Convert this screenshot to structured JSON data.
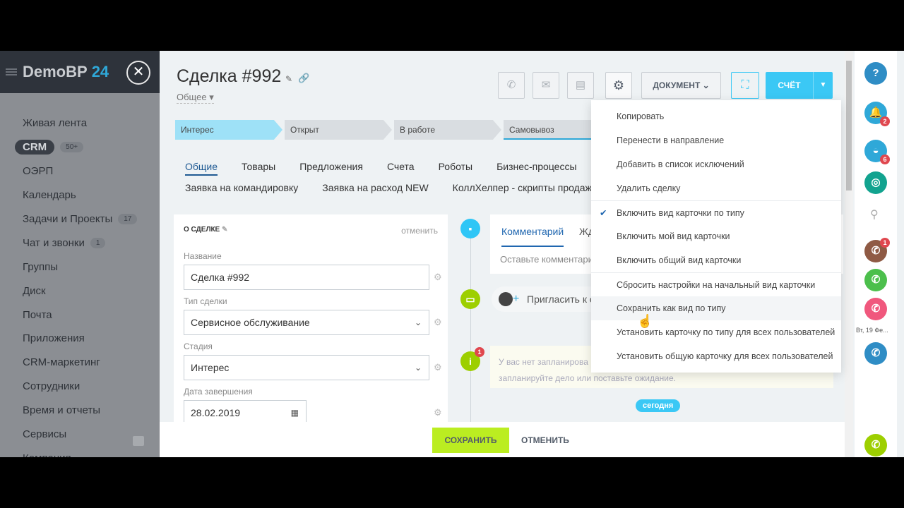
{
  "sidebar": {
    "logo": "DemoBP",
    "logo_num": "24",
    "items": [
      {
        "label": "Живая лента"
      },
      {
        "label": "CRM",
        "count": "50+"
      },
      {
        "label": "ОЭРП"
      },
      {
        "label": "Календарь"
      },
      {
        "label": "Задачи и Проекты",
        "count": "17"
      },
      {
        "label": "Чат и звонки",
        "count": "1"
      },
      {
        "label": "Группы"
      },
      {
        "label": "Диск"
      },
      {
        "label": "Почта"
      },
      {
        "label": "Приложения"
      },
      {
        "label": "CRM-маркетинг"
      },
      {
        "label": "Сотрудники"
      },
      {
        "label": "Время и отчеты"
      },
      {
        "label": "Сервисы"
      },
      {
        "label": "Компания"
      }
    ]
  },
  "header": {
    "title": "Сделка #992",
    "category": "Общее",
    "document_label": "ДОКУМЕНТ",
    "invoice_label": "СЧЁТ"
  },
  "stages": [
    "Интерес",
    "Открыт",
    "В работе",
    "Самовывоз"
  ],
  "tabs": {
    "row1": [
      "Общие",
      "Товары",
      "Предложения",
      "Счета",
      "Роботы",
      "Бизнес-процессы"
    ],
    "row2": [
      "Заявка на командировку",
      "Заявка на расход NEW",
      "КоллХелпер - скрипты продаж"
    ]
  },
  "card": {
    "heading": "О СДЕЛКЕ",
    "cancel": "отменить",
    "fields": [
      {
        "label": "Название",
        "value": "Сделка #992"
      },
      {
        "label": "Тип сделки",
        "value": "Сервисное обслуживание"
      },
      {
        "label": "Стадия",
        "value": "Интерес"
      },
      {
        "label": "Дата завершения",
        "value": "28.02.2019"
      }
    ]
  },
  "timeline": {
    "tab_comment": "Комментарий",
    "tab_wait": "Жд",
    "comment_placeholder": "Оставьте комментарий",
    "invite": "Пригласить к о",
    "notice_line1": "У вас нет запланирова",
    "notice_line2": "запланируйте дело или поставьте ожидание.",
    "notice_badge": "1",
    "today": "сегодня"
  },
  "footer": {
    "save": "СОХРАНИТЬ",
    "cancel": "ОТМЕНИТЬ"
  },
  "dropdown": {
    "items": [
      "Копировать",
      "Перенести в направление",
      "Добавить в список исключений",
      "Удалить сделку",
      "Включить вид карточки по типу",
      "Включить мой вид карточки",
      "Включить общий вид карточки",
      "Сбросить настройки на начальный вид карточки",
      "Сохранить как вид по типу",
      "Установить карточку по типу для всех пользователей",
      "Установить общую карточку для всех пользователей"
    ],
    "checked_index": 4,
    "hover_index": 8
  },
  "right_panel": {
    "notifications_badge": "2",
    "bot_badge": "6",
    "call_badge": "1",
    "date": "Вт, 19 Фе..."
  },
  "colors": {
    "accent": "#3bc8f5",
    "save": "#bbed21",
    "sidebar_header": "#2e333b"
  }
}
